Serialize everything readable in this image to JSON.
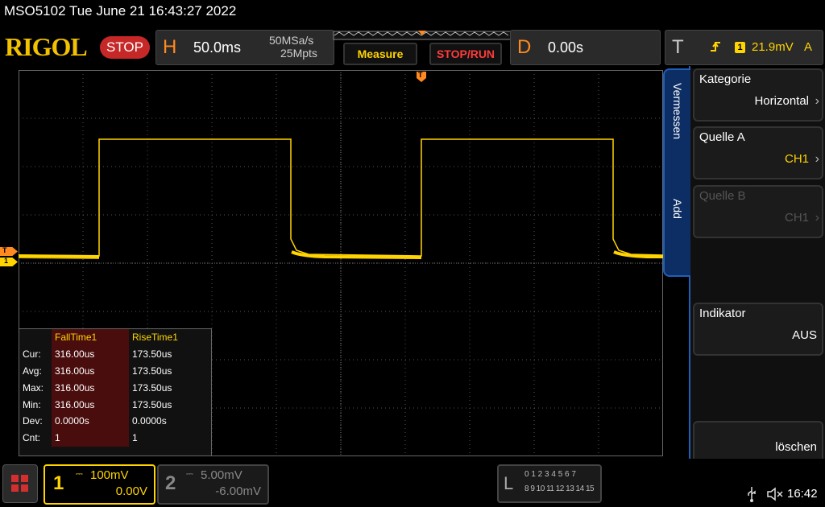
{
  "title": "MSO5102  Tue June 21 16:43:27 2022",
  "header": {
    "logo": "RIGOL",
    "run_state": "STOP",
    "horiz_letter": "H",
    "timebase": "50.0ms",
    "sample_rate": "50MSa/s",
    "memory_depth": "25Mpts",
    "measure_label": "Measure",
    "stoprun_label": "STOP/RUN",
    "delay_letter": "D",
    "delay_value": "0.00s",
    "trigger_letter": "T",
    "trigger_channel": "1",
    "trigger_level": "21.9mV",
    "trigger_mode": "A"
  },
  "side_menu": {
    "tab_top": "Vermessen",
    "tab_bottom": "Add",
    "items": [
      {
        "label": "Kategorie",
        "value": "Horizontal"
      },
      {
        "label": "Quelle A",
        "value": "CH1"
      },
      {
        "label": "Quelle B",
        "value": "CH1"
      },
      {
        "label": "Indikator",
        "value": "AUS"
      },
      {
        "label": "",
        "value": "löschen"
      }
    ]
  },
  "measurements": {
    "columns": [
      "FallTime1",
      "RiseTime1"
    ],
    "rows": [
      {
        "label": "Cur:",
        "a": "316.00us",
        "b": "173.50us"
      },
      {
        "label": "Avg:",
        "a": "316.00us",
        "b": "173.50us"
      },
      {
        "label": "Max:",
        "a": "316.00us",
        "b": "173.50us"
      },
      {
        "label": "Min:",
        "a": "316.00us",
        "b": "173.50us"
      },
      {
        "label": "Dev:",
        "a": "0.0000s",
        "b": "0.0000s"
      },
      {
        "label": "Cnt:",
        "a": "1",
        "b": "1"
      }
    ]
  },
  "channels": [
    {
      "num": "1",
      "scale": "100mV",
      "offset": "0.00V",
      "color": "#ffd400"
    },
    {
      "num": "2",
      "scale": "5.00mV",
      "offset": "-6.00mV",
      "color": "#888888"
    }
  ],
  "markers": {
    "trigger": "T",
    "ch1": "1"
  },
  "la": {
    "letter": "L",
    "row1": "0 1 2 3  4 5 6 7",
    "row2": "8 9 10 11 12 13 14 15"
  },
  "clock": "16:42",
  "colors": {
    "ch1": "#ffd400",
    "accent": "#ff8a1f",
    "menu_blue": "#1f5fb8",
    "stop_red": "#c62828"
  },
  "icons": [
    "menu-grid-icon",
    "usb-icon",
    "speaker-muted-icon",
    "chevron-right-icon",
    "trigger-edge-icon"
  ]
}
